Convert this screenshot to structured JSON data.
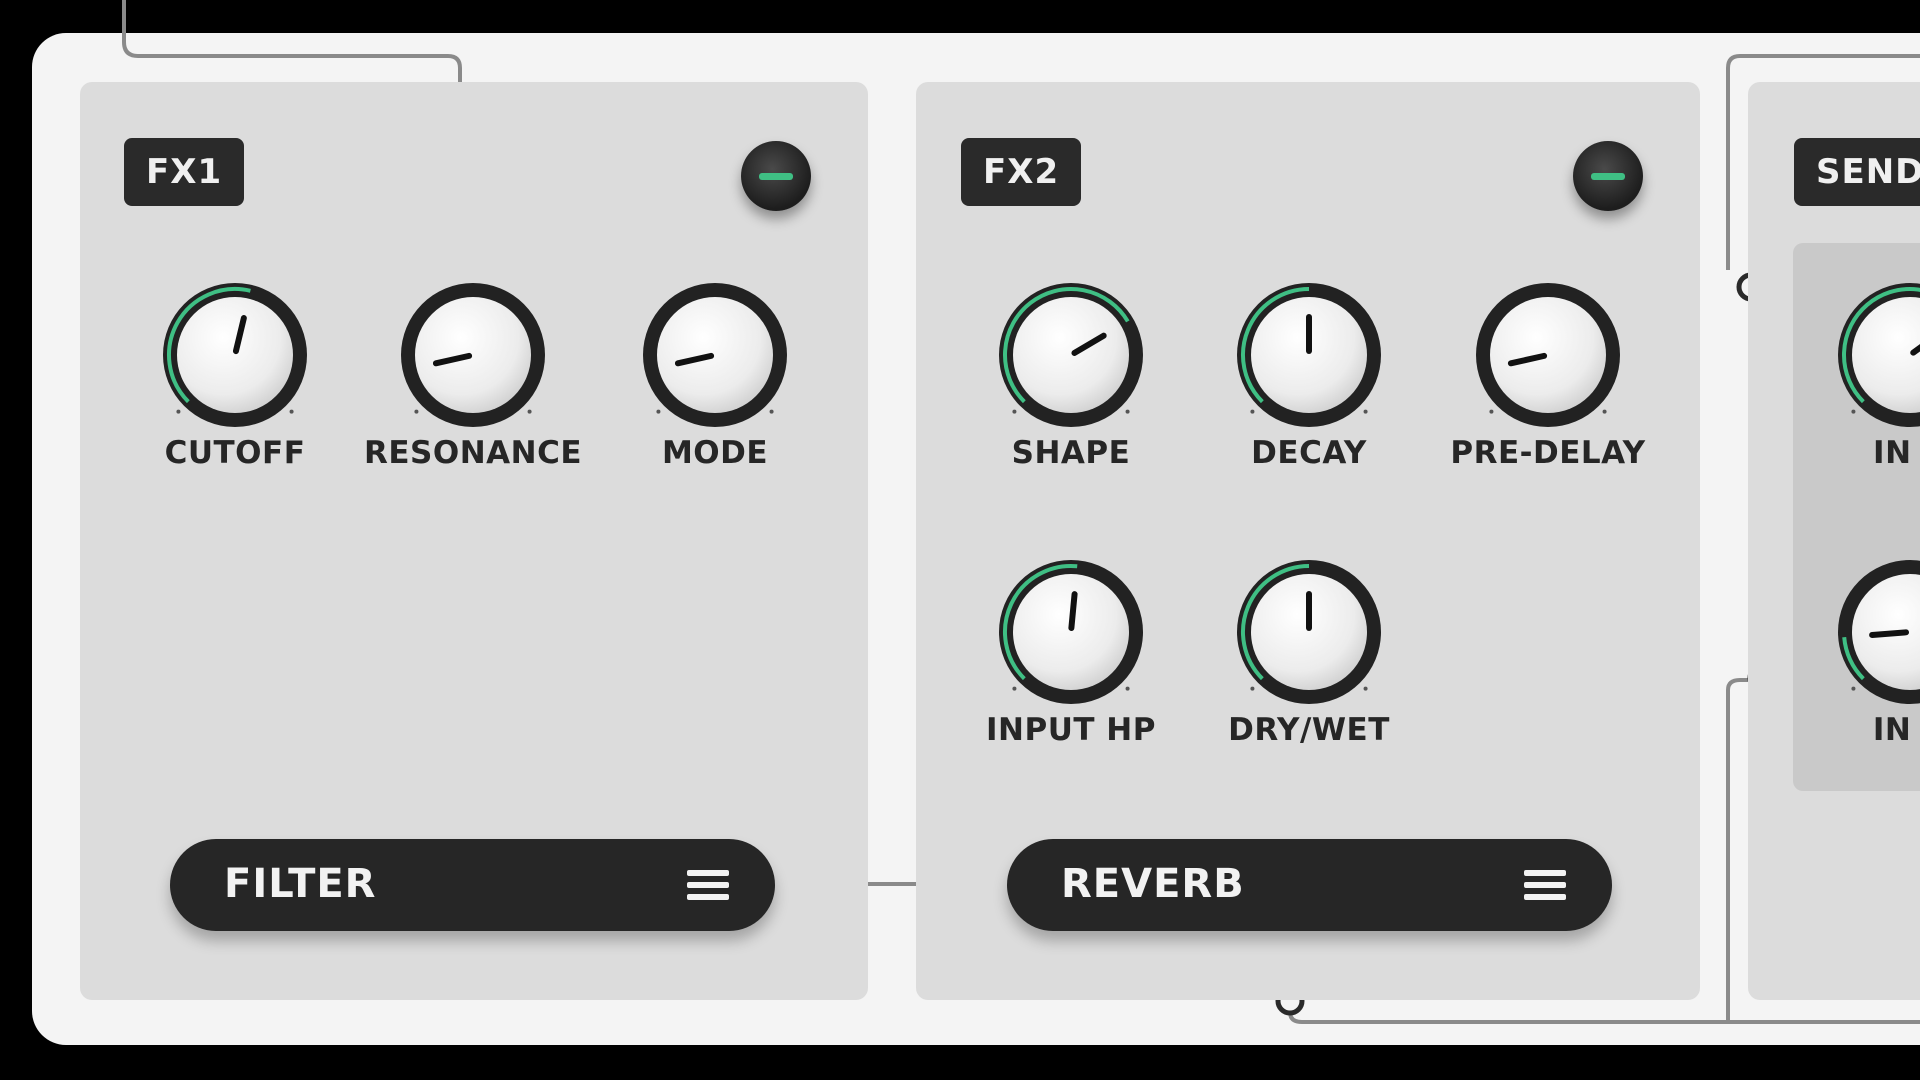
{
  "colors": {
    "accent": "#3fbf84",
    "panel": "#dcdcdc",
    "dark": "#262626",
    "rack": "#f4f4f4"
  },
  "fx1": {
    "tag": "FX1",
    "module_name": "FILTER",
    "menu_icon": "hamburger-menu-icon",
    "knobs": [
      {
        "label": "CUTOFF",
        "value": 0.55
      },
      {
        "label": "RESONANCE",
        "value": 0.12
      },
      {
        "label": "MODE",
        "value": 0.12
      }
    ]
  },
  "fx2": {
    "tag": "FX2",
    "module_name": "REVERB",
    "menu_icon": "hamburger-menu-icon",
    "knobs": [
      {
        "label": "SHAPE",
        "value": 0.72
      },
      {
        "label": "DECAY",
        "value": 0.5
      },
      {
        "label": "PRE-DELAY",
        "value": 0.12
      },
      {
        "label": "INPUT HP",
        "value": 0.52
      },
      {
        "label": "DRY/WET",
        "value": 0.5
      }
    ]
  },
  "send": {
    "tag": "SEND",
    "knobs": [
      {
        "label": "IN B",
        "value": 0.7
      },
      {
        "label": "IN A",
        "value": 0.15
      }
    ]
  }
}
